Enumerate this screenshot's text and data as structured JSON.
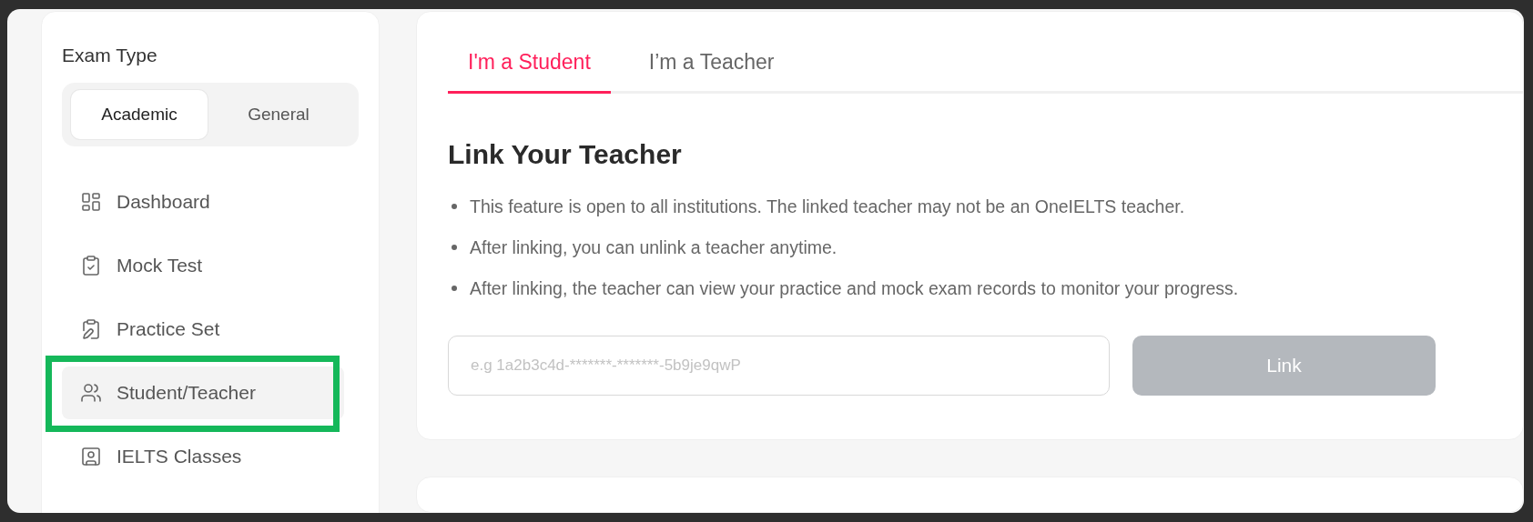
{
  "sidebar": {
    "exam_type": {
      "label": "Exam Type",
      "options": [
        {
          "label": "Academic",
          "selected": true
        },
        {
          "label": "General",
          "selected": false
        }
      ]
    },
    "items": [
      {
        "label": "Dashboard",
        "selected": false,
        "annotated": false
      },
      {
        "label": "Mock Test",
        "selected": false,
        "annotated": false
      },
      {
        "label": "Practice Set",
        "selected": false,
        "annotated": false
      },
      {
        "label": "Student/Teacher",
        "selected": true,
        "annotated": true
      },
      {
        "label": "IELTS Classes",
        "selected": false,
        "annotated": false
      }
    ]
  },
  "main": {
    "tabs": [
      {
        "label": "I'm a Student",
        "selected": true
      },
      {
        "label": "I’m a Teacher",
        "selected": false
      }
    ],
    "heading": "Link Your Teacher",
    "bullets": [
      "This feature is open to all institutions. The linked teacher may not be an OneIELTS teacher.",
      "After linking, you can unlink a teacher anytime.",
      "After linking, the teacher can view your practice and mock exam records to monitor your progress."
    ],
    "code_field": {
      "placeholder": "e.g 1a2b3c4d-*******-*******-5b9je9qwP"
    },
    "link_button": {
      "label": "Link",
      "disabled": true
    }
  }
}
